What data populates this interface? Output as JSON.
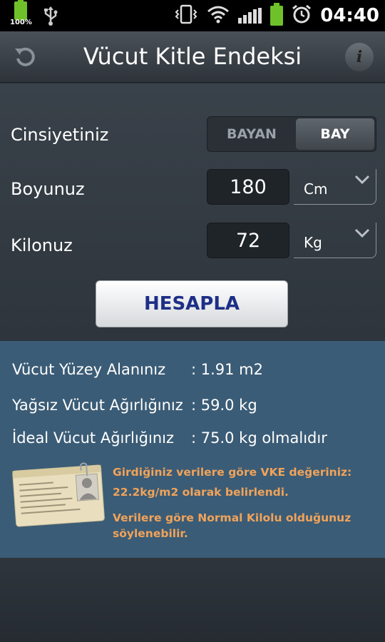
{
  "status_bar": {
    "battery_percent": "100%",
    "time": "04:40"
  },
  "header": {
    "title": "Vücut Kitle Endeksi",
    "refresh_icon": "refresh-icon",
    "info_icon": "info-icon",
    "info_glyph": "i"
  },
  "form": {
    "gender_label": "Cinsiyetiniz",
    "gender_options": [
      "BAYAN",
      "BAY"
    ],
    "gender_selected": "BAY",
    "height_label": "Boyunuz",
    "height_value": "180",
    "height_unit": "Cm",
    "weight_label": "Kilonuz",
    "weight_value": "72",
    "weight_unit": "Kg",
    "calculate_label": "HESAPLA"
  },
  "results": {
    "rows": [
      {
        "label": "Vücut Yüzey Alanınız",
        "value": ": 1.91 m2"
      },
      {
        "label": "Yağsız Vücut Ağırlığınız",
        "value": ": 59.0 kg"
      },
      {
        "label": "İdeal Vücut Ağırlığınız",
        "value": ": 75.0 kg olmalıdır"
      }
    ],
    "message_1a": "Girdiğiniz verilere göre VKE değeriniz:",
    "message_1b": "22.2kg/m2 olarak belirlendi.",
    "message_2a": "Verilere göre Normal Kilolu olduğunuz",
    "message_2b": "söylenebilir."
  },
  "colors": {
    "accent_orange": "#f0a35a",
    "button_text": "#1e2f86",
    "results_bg": "#3b5c76"
  }
}
